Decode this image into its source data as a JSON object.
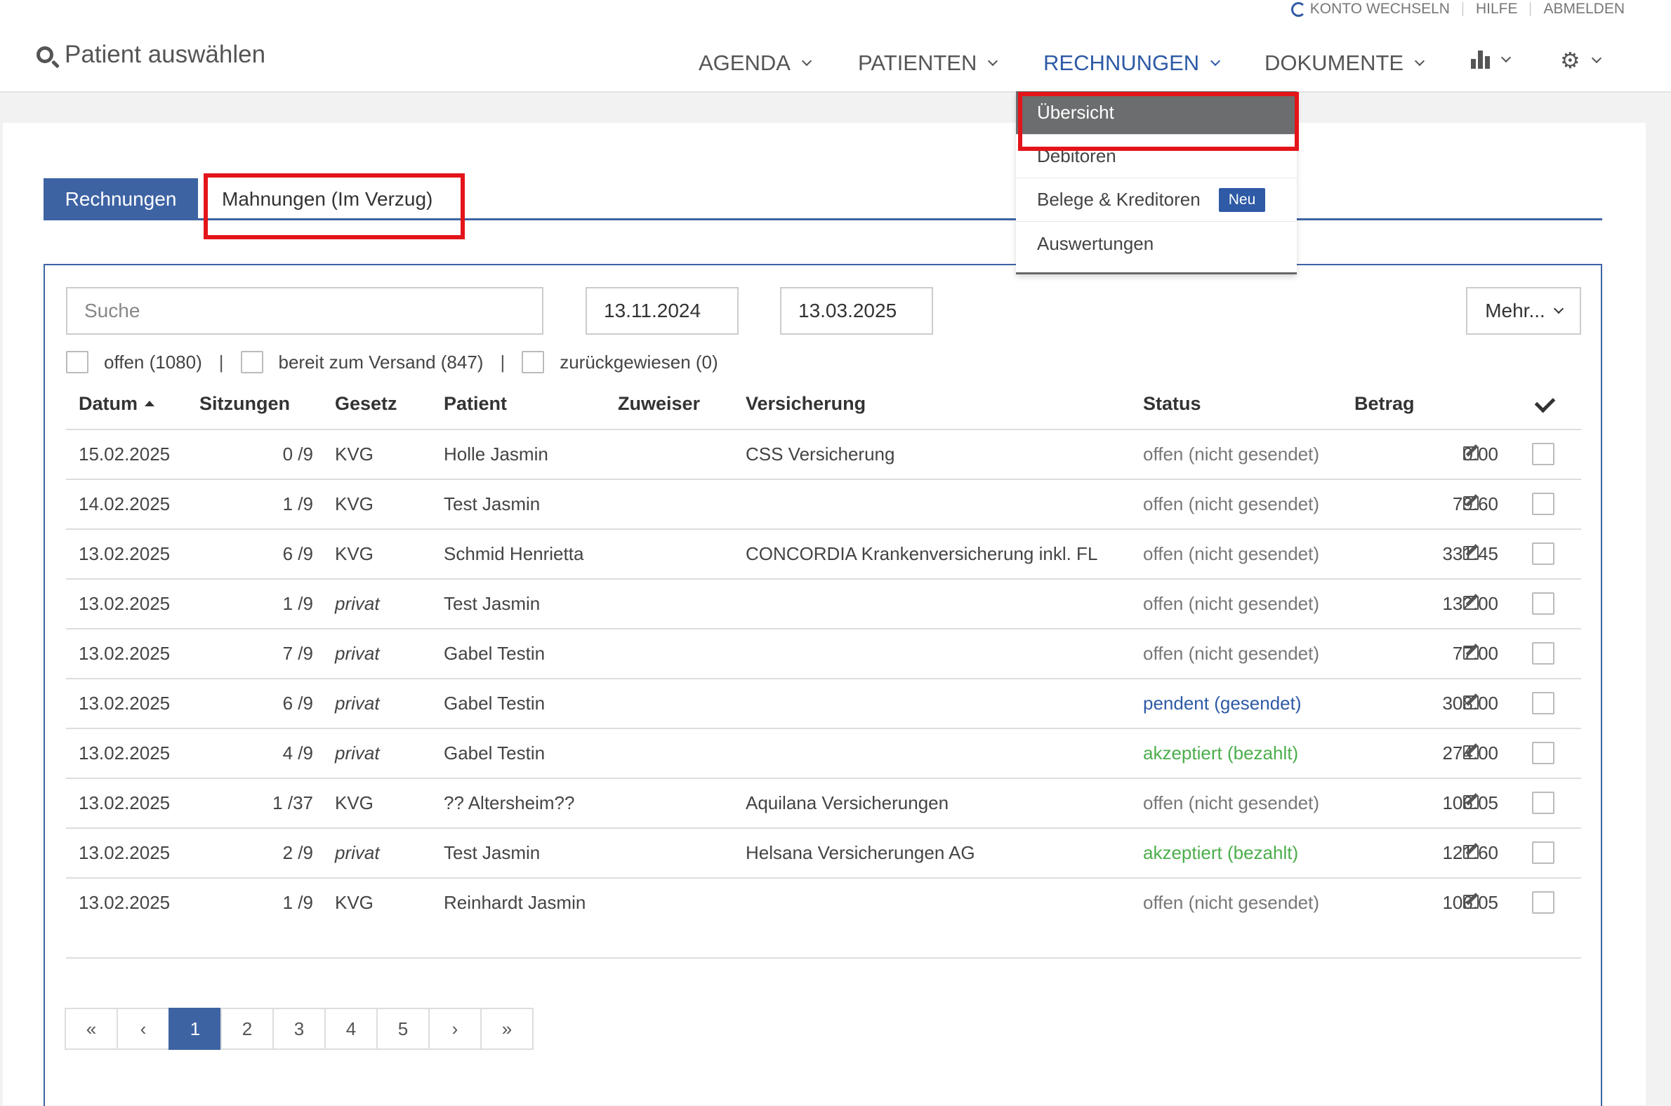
{
  "toplinks": {
    "switch_account": "KONTO WECHSELN",
    "help": "HILFE",
    "logout": "ABMELDEN"
  },
  "patient_select": "Patient auswählen",
  "nav": {
    "agenda": "AGENDA",
    "patienten": "PATIENTEN",
    "rechnungen": "RECHNUNGEN",
    "dokumente": "DOKUMENTE"
  },
  "dropdown": {
    "items": [
      "Übersicht",
      "Debitoren",
      "Belege & Kreditoren",
      "Auswertungen"
    ],
    "badge": "Neu"
  },
  "tabs": {
    "rechnungen": "Rechnungen",
    "mahnungen": "Mahnungen (Im Verzug)"
  },
  "search": {
    "placeholder": "Suche"
  },
  "dates": {
    "from": "13.11.2024",
    "to": "13.03.2025"
  },
  "more_button": "Mehr...",
  "filters": {
    "offen": "offen (1080)",
    "bereit": "bereit zum Versand (847)",
    "zurueck": "zurückgewiesen (0)",
    "sep": "|"
  },
  "table": {
    "headers": {
      "datum": "Datum",
      "sitzungen": "Sitzungen",
      "gesetz": "Gesetz",
      "patient": "Patient",
      "zuweiser": "Zuweiser",
      "versicherung": "Versicherung",
      "status": "Status",
      "betrag": "Betrag"
    },
    "rows": [
      {
        "datum": "15.02.2025",
        "sitzungen": "0 /9",
        "gesetz": "KVG",
        "patient": "Holle Jasmin",
        "versicherung": "CSS Versicherung",
        "status": "offen (nicht gesendet)",
        "betrag": "0.00"
      },
      {
        "datum": "14.02.2025",
        "sitzungen": "1 /9",
        "gesetz": "KVG",
        "patient": "Test Jasmin",
        "versicherung": "",
        "status": "offen (nicht gesendet)",
        "betrag": "79.60"
      },
      {
        "datum": "13.02.2025",
        "sitzungen": "6 /9",
        "gesetz": "KVG",
        "patient": "Schmid Henrietta",
        "versicherung": "CONCORDIA Krankenversicherung inkl. FL",
        "status": "offen (nicht gesendet)",
        "betrag": "331.45"
      },
      {
        "datum": "13.02.2025",
        "sitzungen": "1 /9",
        "gesetz": "privat",
        "patient": "Test Jasmin",
        "versicherung": "",
        "status": "offen (nicht gesendet)",
        "betrag": "132.00"
      },
      {
        "datum": "13.02.2025",
        "sitzungen": "7 /9",
        "gesetz": "privat",
        "patient": "Gabel Testin",
        "versicherung": "",
        "status": "offen (nicht gesendet)",
        "betrag": "77.00"
      },
      {
        "datum": "13.02.2025",
        "sitzungen": "6 /9",
        "gesetz": "privat",
        "patient": "Gabel Testin",
        "versicherung": "",
        "status": "pendent (gesendet)",
        "betrag": "308.00"
      },
      {
        "datum": "13.02.2025",
        "sitzungen": "4 /9",
        "gesetz": "privat",
        "patient": "Gabel Testin",
        "versicherung": "",
        "status": "akzeptiert (bezahlt)",
        "betrag": "274.00"
      },
      {
        "datum": "13.02.2025",
        "sitzungen": "1 /37",
        "gesetz": "KVG",
        "patient": "?? Altersheim??",
        "versicherung": "Aquilana Versicherungen",
        "status": "offen (nicht gesendet)",
        "betrag": "106.05"
      },
      {
        "datum": "13.02.2025",
        "sitzungen": "2 /9",
        "gesetz": "privat",
        "patient": "Test Jasmin",
        "versicherung": "Helsana Versicherungen AG",
        "status": "akzeptiert (bezahlt)",
        "betrag": "121.60"
      },
      {
        "datum": "13.02.2025",
        "sitzungen": "1 /9",
        "gesetz": "KVG",
        "patient": "Reinhardt Jasmin",
        "versicherung": "",
        "status": "offen (nicht gesendet)",
        "betrag": "106.05"
      }
    ]
  },
  "pagination": [
    "«",
    "‹",
    "1",
    "2",
    "3",
    "4",
    "5",
    "›",
    "»"
  ],
  "colors": {
    "accent": "#3d63a3",
    "link": "#2e5aa6",
    "paid": "#4cae4c",
    "highlight": "#e3141a"
  }
}
